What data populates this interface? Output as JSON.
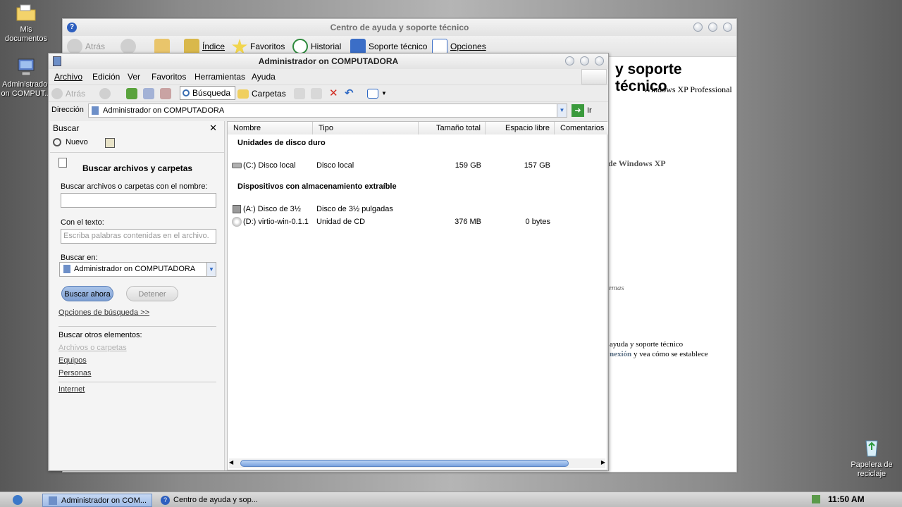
{
  "desktop": {
    "my_docs": "Mis documentos",
    "admin": "Administrador on COMPUT...",
    "recycle": "Papelera de reciclaje"
  },
  "help_window": {
    "title": "Centro de ayuda y soporte técnico",
    "toolbar": {
      "back": "Atrás",
      "index": "Índice",
      "favorites": "Favoritos",
      "history": "Historial",
      "support": "Soporte técnico",
      "options": "Opciones"
    },
    "heading": "y soporte técnico",
    "edition": "Windows XP Professional",
    "frag1": "de Windows XP",
    "frag2": "emas",
    "frag3": "ayuda y soporte técnico",
    "frag4a": "nexión",
    "frag4b": " y vea cómo se establece"
  },
  "explorer": {
    "title": "Administrador on COMPUTADORA",
    "menu": {
      "file": "Archivo",
      "edit": "Edición",
      "view": "Ver",
      "favorites": "Favoritos",
      "tools": "Herramientas",
      "help": "Ayuda"
    },
    "toolbar": {
      "back": "Atrás",
      "search": "Búsqueda",
      "folders": "Carpetas"
    },
    "address": {
      "label": "Dirección",
      "value": "Administrador on COMPUTADORA",
      "go": "Ir"
    }
  },
  "search": {
    "pane_title": "Buscar",
    "new_label": "Nuevo",
    "heading": "Buscar archivos y carpetas",
    "name_label": "Buscar archivos o carpetas con el nombre:",
    "name_value": "",
    "text_label": "Con el texto:",
    "text_placeholder": "Escriba palabras contenidas en el archivo.",
    "lookin_label": "Buscar en:",
    "lookin_value": "Administrador on COMPUTADORA",
    "search_btn": "Buscar ahora",
    "stop_btn": "Detener",
    "options_link": "Opciones de búsqueda  >>",
    "other_label": "Buscar otros elementos:",
    "other_files": "Archivos o carpetas",
    "other_computers": "Equipos",
    "other_people": "Personas",
    "internet": "Internet"
  },
  "file_list": {
    "columns": [
      "Nombre",
      "Tipo",
      "Tamaño total",
      "Espacio libre",
      "Comentarios"
    ],
    "group_hdd": "Unidades de disco duro",
    "group_removable": "Dispositivos con almacenamiento extraíble",
    "hdd": [
      {
        "name": "(C:) Disco local",
        "type": "Disco local",
        "total": "159 GB",
        "free": "157 GB"
      }
    ],
    "removable": [
      {
        "name": "(A:) Disco de 3½",
        "type": "Disco de 3½ pulgadas",
        "total": "",
        "free": ""
      },
      {
        "name": "(D:) virtio-win-0.1.1",
        "type": "Unidad de CD",
        "total": "376 MB",
        "free": "0 bytes"
      }
    ]
  },
  "taskbar": {
    "task1": "Administrador on COM...",
    "task2": "Centro de ayuda y sop...",
    "clock": "11:50 AM"
  }
}
